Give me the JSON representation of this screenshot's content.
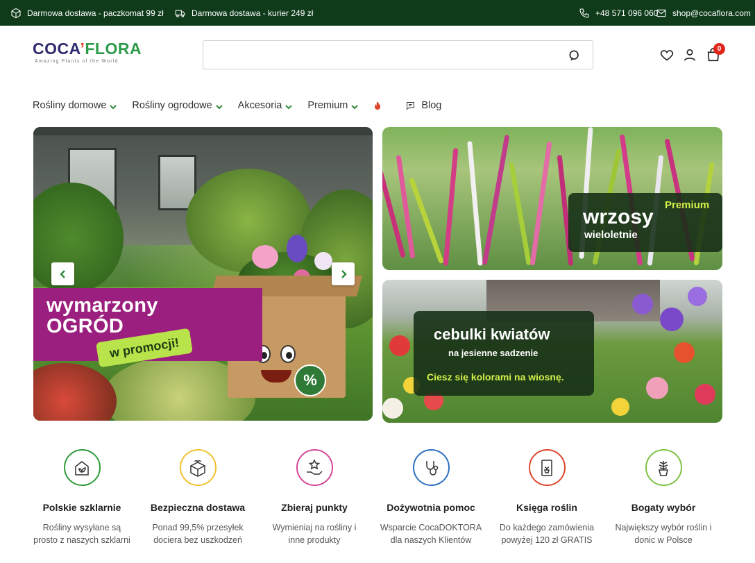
{
  "topbar": {
    "shipping_parcel": "Darmowa dostawa - paczkomat 99 zł",
    "shipping_courier": "Darmowa dostawa - kurier 249 zł",
    "phone": "+48 571 096 060",
    "email": "shop@cocaflora.com"
  },
  "logo": {
    "word_left": "COCA",
    "word_right": "FLORA",
    "tagline": "Amazing Plants of the World"
  },
  "search": {
    "placeholder": ""
  },
  "cart": {
    "count": "0"
  },
  "nav": {
    "items": [
      {
        "label": "Rośliny domowe"
      },
      {
        "label": "Rośliny ogrodowe"
      },
      {
        "label": "Akcesoria"
      },
      {
        "label": "Premium"
      }
    ],
    "blog": "Blog"
  },
  "hero": {
    "main": {
      "title_line1": "wymarzony",
      "title_line2": "OGRÓD",
      "tag": "w promocji!",
      "badge": "%"
    },
    "top_right": {
      "premium": "Premium",
      "title": "wrzosy",
      "subtitle": "wieloletnie"
    },
    "bottom_right": {
      "title": "cebulki kwiatów",
      "subtitle": "na jesienne sadzenie",
      "note": "Ciesz się kolorami na wiosnę."
    }
  },
  "features": [
    {
      "icon": "greenhouse-icon",
      "color": "#2e9b3a",
      "title": "Polskie szklarnie",
      "desc_line1": "Rośliny wysyłane są",
      "desc_line2": "prosto z naszych szklarni"
    },
    {
      "icon": "box-icon",
      "color": "#f2c12e",
      "title": "Bezpieczna dostawa",
      "desc_line1": "Ponad 99,5% przesyłek",
      "desc_line2": "dociera bez uszkodzeń"
    },
    {
      "icon": "star-hand-icon",
      "color": "#d6449a",
      "title": "Zbieraj punkty",
      "desc_line1": "Wymieniaj na rośliny i",
      "desc_line2": "inne produkty"
    },
    {
      "icon": "stethoscope-icon",
      "color": "#2d6fc2",
      "title": "Dożywotnia pomoc",
      "desc_line1": "Wsparcie CocaDOKTORA",
      "desc_line2": "dla naszych Klientów"
    },
    {
      "icon": "book-icon",
      "color": "#e0452b",
      "title": "Księga roślin",
      "desc_line1": "Do każdego zamówienia",
      "desc_line2": "powyżej 120 zł GRATIS"
    },
    {
      "icon": "potted-plant-icon",
      "color": "#7cc243",
      "title": "Bogaty wybór",
      "desc_line1": "Największy wybór roślin i",
      "desc_line2": "donic w Polsce"
    }
  ]
}
